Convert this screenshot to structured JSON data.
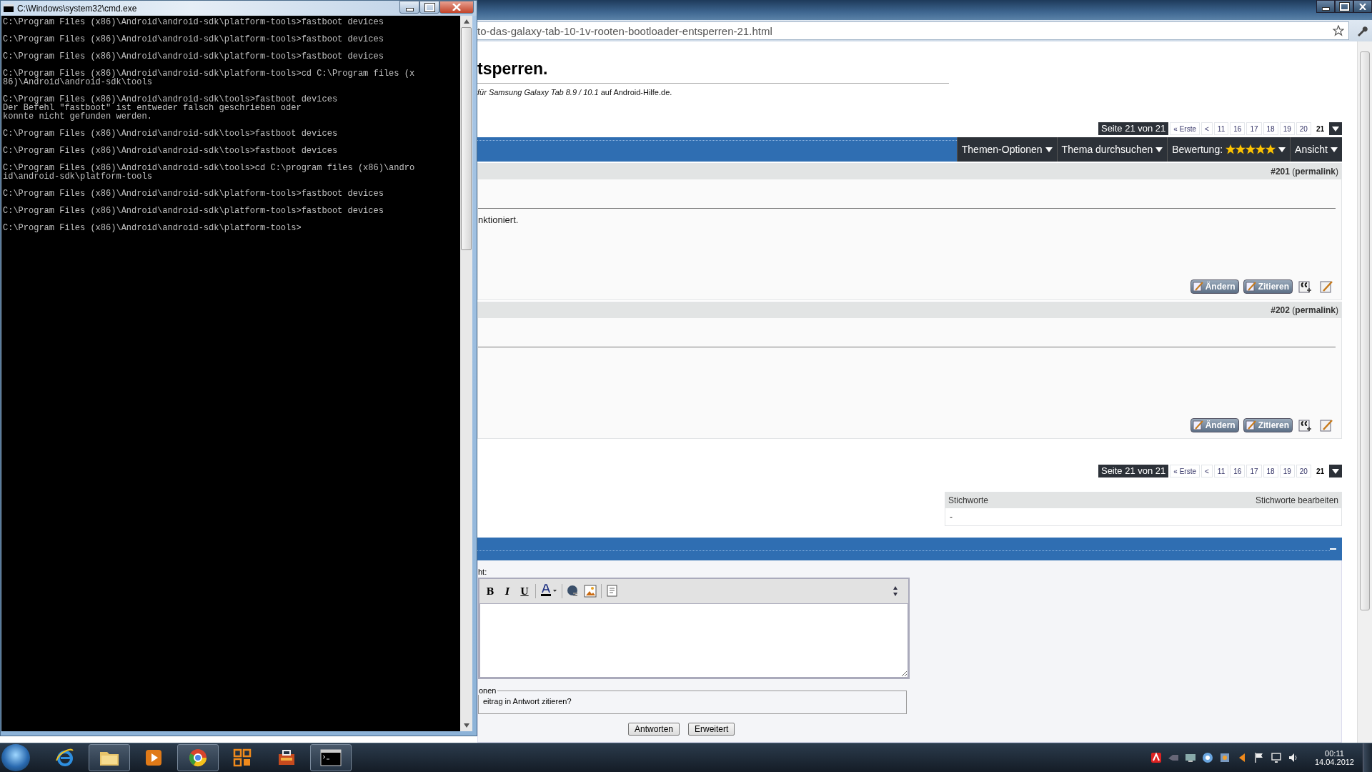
{
  "cmd_window": {
    "title": "C:\\Windows\\system32\\cmd.exe",
    "output": [
      [
        "C:\\Program Files (x86)\\Android\\android-sdk\\platform-tools>fastboot devices"
      ],
      [
        "C:\\Program Files (x86)\\Android\\android-sdk\\platform-tools>fastboot devices"
      ],
      [
        "C:\\Program Files (x86)\\Android\\android-sdk\\platform-tools>fastboot devices"
      ],
      [
        "C:\\Program Files (x86)\\Android\\android-sdk\\platform-tools>cd C:\\Program files (x",
        "86)\\Android\\android-sdk\\tools"
      ],
      [
        "C:\\Program Files (x86)\\Android\\android-sdk\\tools>fastboot devices",
        "Der Befehl \"fastboot\" ist entweder falsch geschrieben oder",
        "konnte nicht gefunden werden."
      ],
      [
        "C:\\Program Files (x86)\\Android\\android-sdk\\tools>fastboot devices"
      ],
      [
        "C:\\Program Files (x86)\\Android\\android-sdk\\tools>fastboot devices"
      ],
      [
        "C:\\Program Files (x86)\\Android\\android-sdk\\tools>cd C:\\program files (x86)\\andro",
        "id\\android-sdk\\platform-tools"
      ],
      [
        "C:\\Program Files (x86)\\Android\\android-sdk\\platform-tools>fastboot devices"
      ],
      [
        "C:\\Program Files (x86)\\Android\\android-sdk\\platform-tools>fastboot devices"
      ],
      [
        "C:\\Program Files (x86)\\Android\\android-sdk\\platform-tools>"
      ]
    ]
  },
  "browser": {
    "address": "to-das-galaxy-tab-10-1v-rooten-bootloader-entsperren-21.html",
    "page_title": "tsperren.",
    "subtitle": "*für Samsung Galaxy Tab 8.9 / 10.1* auf Android-Hilfe.de.",
    "pagination_top": {
      "label": "Seite 21 von 21",
      "pages": [
        {
          "label": "« Erste",
          "selected": false
        },
        {
          "label": "<",
          "selected": false
        },
        {
          "label": "11",
          "selected": false
        },
        {
          "label": "16",
          "selected": false
        },
        {
          "label": "17",
          "selected": false
        },
        {
          "label": "18",
          "selected": false
        },
        {
          "label": "19",
          "selected": false
        },
        {
          "label": "20",
          "selected": false
        },
        {
          "label": "21",
          "selected": true
        }
      ]
    },
    "thread_tools": [
      {
        "label": "Themen-Optionen"
      },
      {
        "label": "Thema durchsuchen"
      },
      {
        "label": "Bewertung:",
        "stars": 5
      },
      {
        "label": "Ansicht"
      }
    ],
    "posts": [
      {
        "header": "**#201** (**permalink**)",
        "text": "nktioniert.",
        "buttons": [
          "Ändern",
          "Zitieren"
        ]
      },
      {
        "header": "**#202** (**permalink**)",
        "buttons": [
          "Ändern",
          "Zitieren"
        ]
      }
    ],
    "pagination_bottom": {
      "label": "Seite 21 von 21",
      "pages": [
        {
          "label": "« Erste",
          "selected": false
        },
        {
          "label": "<",
          "selected": false
        },
        {
          "label": "11",
          "selected": false
        },
        {
          "label": "16",
          "selected": false
        },
        {
          "label": "17",
          "selected": false
        },
        {
          "label": "18",
          "selected": false
        },
        {
          "label": "19",
          "selected": false
        },
        {
          "label": "20",
          "selected": false
        },
        {
          "label": "21",
          "selected": true
        }
      ]
    },
    "tags": {
      "title": "Stichworte",
      "edit_link": "Stichworte bearbeiten",
      "value": "-"
    },
    "reply": {
      "message_label": "ht:",
      "format_buttons": [
        "B",
        "I",
        "U"
      ],
      "options_legend": "onen",
      "quote_option": "eitrag in Antwort zitieren?",
      "buttons": [
        "Antworten",
        "Erweitert"
      ]
    }
  },
  "taskbar": {
    "apps": [
      {
        "kind": "ie",
        "running": false
      },
      {
        "kind": "explorer",
        "running": true
      },
      {
        "kind": "media",
        "running": false
      },
      {
        "kind": "chrome",
        "running": true
      },
      {
        "kind": "grid",
        "running": false
      },
      {
        "kind": "tool",
        "running": false
      },
      {
        "kind": "cmd",
        "running": true
      }
    ],
    "time": "00:11",
    "date": "14.04.2012"
  }
}
